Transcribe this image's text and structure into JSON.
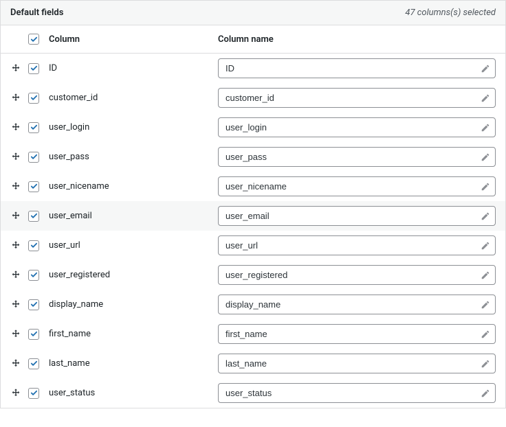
{
  "header": {
    "title": "Default fields",
    "count_text": "47 columns(s) selected"
  },
  "columns_header": {
    "col_label": "Column",
    "name_label": "Column name"
  },
  "master_checked": true,
  "rows": [
    {
      "checked": true,
      "label": "ID",
      "value": "ID",
      "highlight": false
    },
    {
      "checked": true,
      "label": "customer_id",
      "value": "customer_id",
      "highlight": false
    },
    {
      "checked": true,
      "label": "user_login",
      "value": "user_login",
      "highlight": false
    },
    {
      "checked": true,
      "label": "user_pass",
      "value": "user_pass",
      "highlight": false
    },
    {
      "checked": true,
      "label": "user_nicename",
      "value": "user_nicename",
      "highlight": false
    },
    {
      "checked": true,
      "label": "user_email",
      "value": "user_email",
      "highlight": true
    },
    {
      "checked": true,
      "label": "user_url",
      "value": "user_url",
      "highlight": false
    },
    {
      "checked": true,
      "label": "user_registered",
      "value": "user_registered",
      "highlight": false
    },
    {
      "checked": true,
      "label": "display_name",
      "value": "display_name",
      "highlight": false
    },
    {
      "checked": true,
      "label": "first_name",
      "value": "first_name",
      "highlight": false
    },
    {
      "checked": true,
      "label": "last_name",
      "value": "last_name",
      "highlight": false
    },
    {
      "checked": true,
      "label": "user_status",
      "value": "user_status",
      "highlight": false
    }
  ]
}
